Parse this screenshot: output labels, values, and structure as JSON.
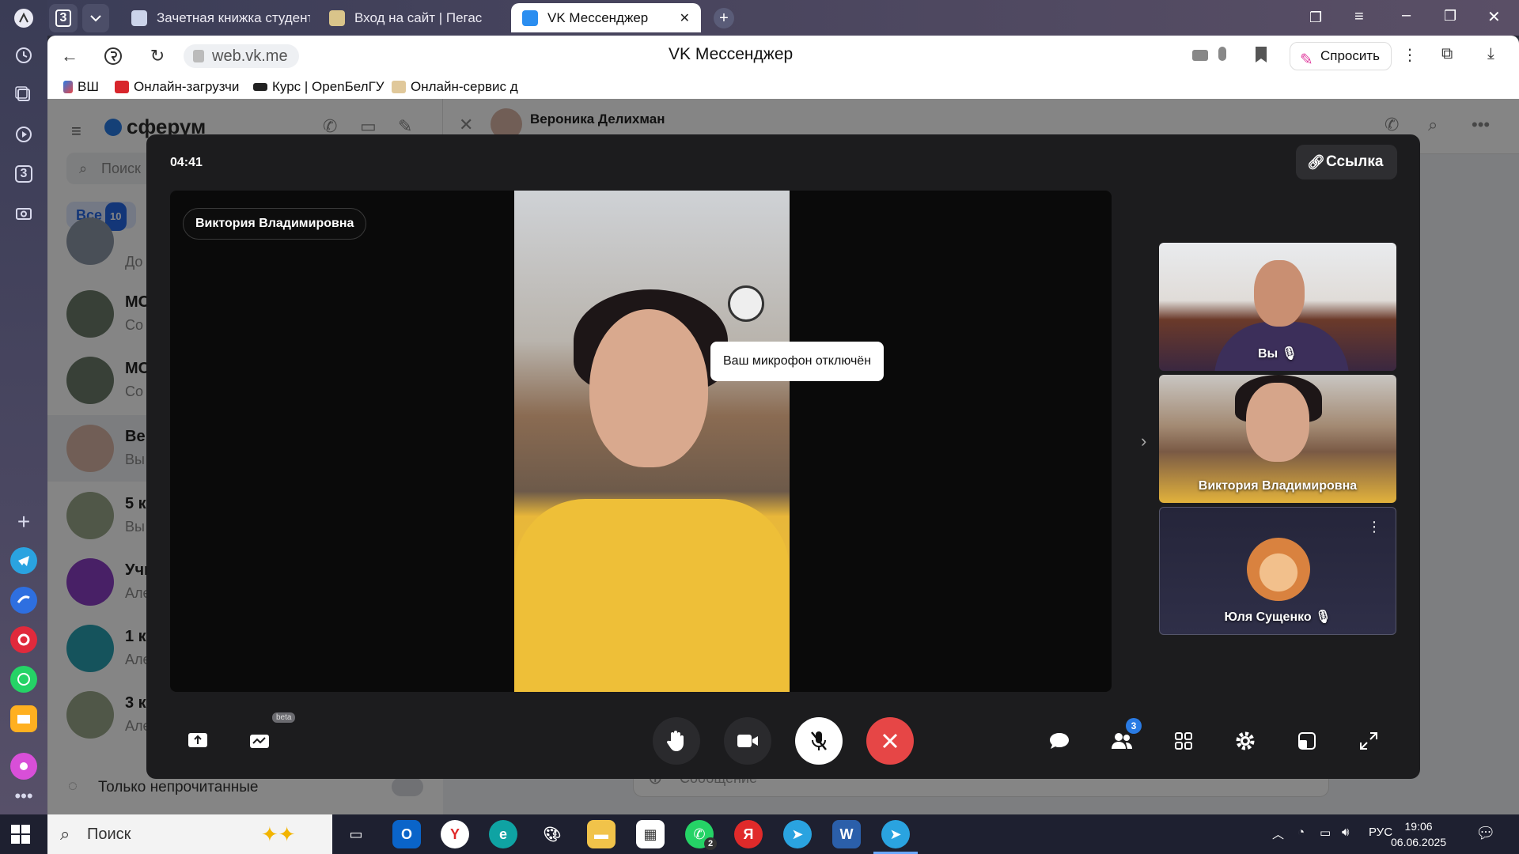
{
  "browser": {
    "tab_count_badge": "3",
    "tabs": [
      {
        "label": "Зачетная книжка студент"
      },
      {
        "label": "Вход на сайт | Пегас"
      },
      {
        "label": "VK Мессенджер"
      }
    ],
    "url": "web.vk.me",
    "page_title": "VK Мессенджер",
    "ask_label": "Спросить",
    "bookmarks": [
      {
        "label": "ВШ"
      },
      {
        "label": "Онлайн-загрузчи"
      },
      {
        "label": "Курс | OpenБелГУ"
      },
      {
        "label": "Онлайн-сервис д"
      }
    ],
    "rail_badge": "3"
  },
  "messenger": {
    "logo": "сферум",
    "search_placeholder": "Поиск",
    "filter_all": "Все",
    "filter_all_count": "10",
    "chats": [
      {
        "name": "",
        "preview": "До"
      },
      {
        "name": "МС",
        "preview": "Со"
      },
      {
        "name": "МС",
        "preview": "Со"
      },
      {
        "name": "Вер",
        "preview": "Вы"
      },
      {
        "name": "5 к",
        "preview": "Вы"
      },
      {
        "name": "Учи",
        "preview": "Але"
      },
      {
        "name": "1 кл",
        "preview": "Але"
      },
      {
        "name": "3 к",
        "preview": "Але"
      }
    ],
    "unread_only": "Только непрочитанные",
    "chat_header_name": "Вероника Делихман",
    "message_placeholder": "Сообщение"
  },
  "call": {
    "timer": "04:41",
    "link_button": "Ссылка",
    "speaker_name": "Виктория Владимировна",
    "toast": "Ваш микрофон отключён",
    "participants": [
      {
        "name": "Вы",
        "muted": true
      },
      {
        "name": "Виктория Владимировна",
        "muted": false
      },
      {
        "name": "Юля Сущенко",
        "muted": true
      }
    ],
    "beta_label": "beta",
    "participants_badge": "3",
    "colors": {
      "end_call": "#e64646",
      "accent": "#2a7be4"
    }
  },
  "taskbar": {
    "search_label": "Поиск",
    "whatsapp_badge": "2",
    "language": "РУС",
    "time": "19:06",
    "date": "06.06.2025"
  }
}
